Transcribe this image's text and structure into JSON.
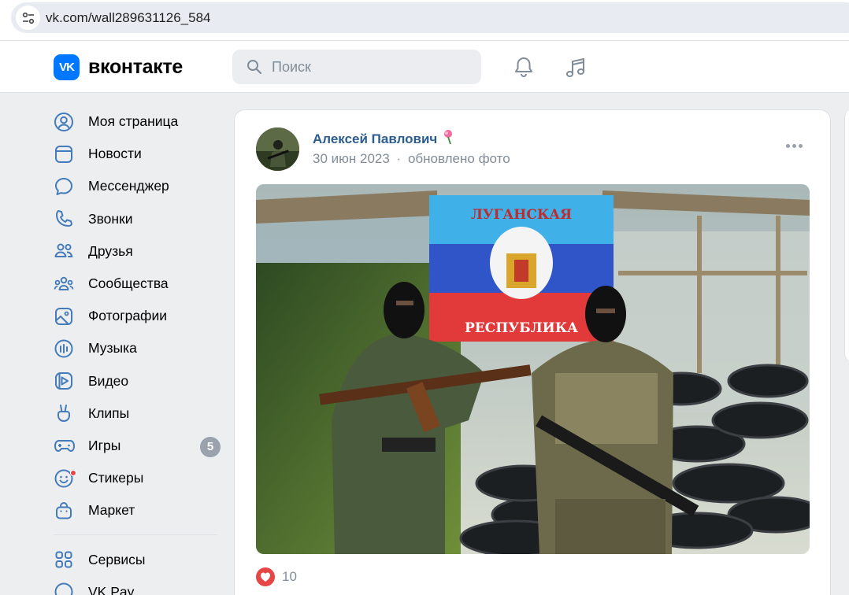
{
  "browser": {
    "url": "vk.com/wall289631126_584"
  },
  "header": {
    "logo_badge": "VK",
    "logo_text": "вконтакте",
    "search_placeholder": "Поиск"
  },
  "sidebar": {
    "items": [
      {
        "label": "Моя страница",
        "icon": "user-circle-icon"
      },
      {
        "label": "Новости",
        "icon": "news-icon"
      },
      {
        "label": "Мессенджер",
        "icon": "chat-bubble-icon"
      },
      {
        "label": "Звонки",
        "icon": "phone-icon"
      },
      {
        "label": "Друзья",
        "icon": "friends-icon"
      },
      {
        "label": "Сообщества",
        "icon": "communities-icon"
      },
      {
        "label": "Фотографии",
        "icon": "photo-icon"
      },
      {
        "label": "Музыка",
        "icon": "music-bars-icon"
      },
      {
        "label": "Видео",
        "icon": "video-play-icon"
      },
      {
        "label": "Клипы",
        "icon": "clips-hand-icon"
      },
      {
        "label": "Игры",
        "icon": "gamepad-icon",
        "badge": "5"
      },
      {
        "label": "Стикеры",
        "icon": "sticker-smile-icon"
      },
      {
        "label": "Маркет",
        "icon": "market-bag-icon"
      }
    ],
    "secondary": [
      {
        "label": "Сервисы",
        "icon": "services-grid-icon"
      },
      {
        "label": "VK Pay",
        "icon": "vkpay-icon"
      }
    ]
  },
  "post": {
    "author": "Алексей Павлович",
    "date": "30 июн 2023",
    "separator": "·",
    "action": "обновлено фото",
    "likes": "10",
    "photo_banner_top": "ЛУГАНСКАЯ",
    "photo_banner_bottom": "РЕСПУБЛИКА"
  },
  "colors": {
    "accent": "#0077ff",
    "link": "#2c5d8f",
    "like": "#e64646",
    "flag_blue": "#2f7fd0",
    "flag_top": "#3fb0e8",
    "flag_red": "#e23a3a"
  }
}
